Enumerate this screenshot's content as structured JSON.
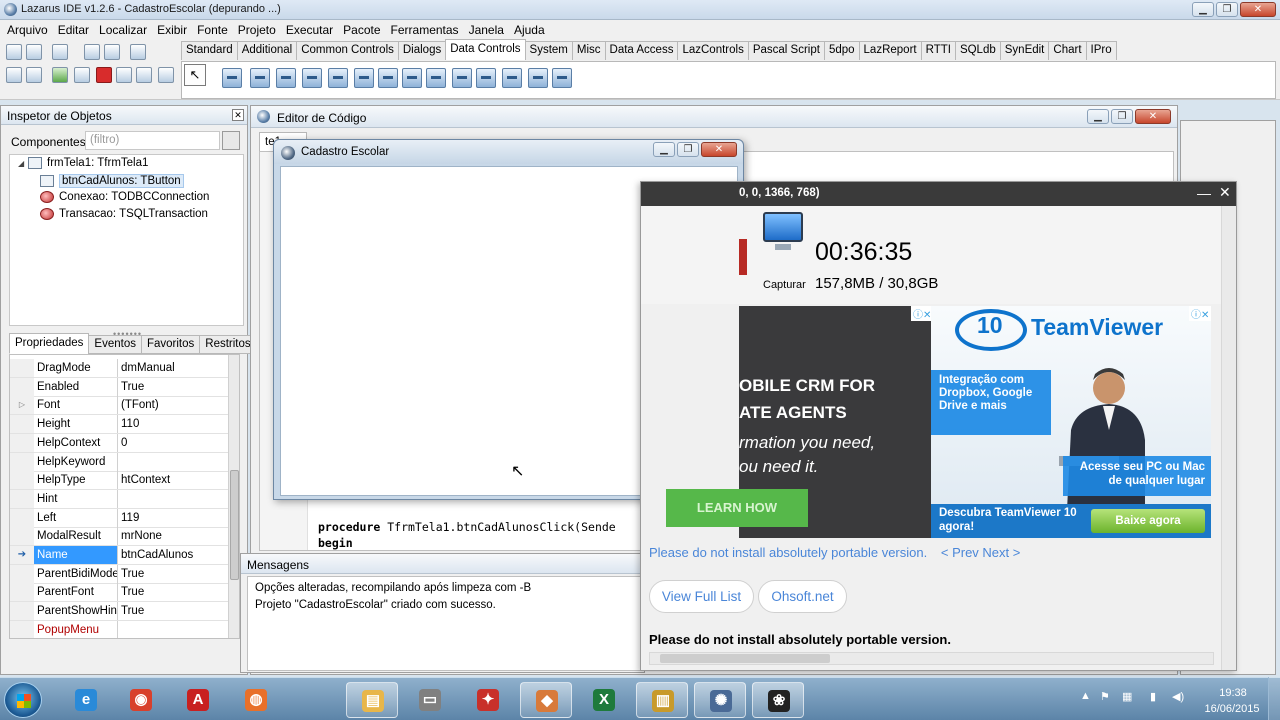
{
  "ide": {
    "title": "Lazarus IDE v1.2.6 - CadastroEscolar (depurando ...)",
    "menu": [
      "Arquivo",
      "Editar",
      "Localizar",
      "Exibir",
      "Fonte",
      "Projeto",
      "Executar",
      "Pacote",
      "Ferramentas",
      "Janela",
      "Ajuda"
    ],
    "palette_tabs": [
      "Standard",
      "Additional",
      "Common Controls",
      "Dialogs",
      "Data Controls",
      "System",
      "Misc",
      "Data Access",
      "LazControls",
      "Pascal Script",
      "5dpo",
      "LazReport",
      "RTTI",
      "SQLdb",
      "SynEdit",
      "Chart",
      "IPro"
    ],
    "active_palette_tab": "Data Controls"
  },
  "inspector": {
    "title": "Inspetor de Objetos",
    "components_label": "Componentes",
    "filter_placeholder": "(filtro)",
    "tree": [
      {
        "label": "frmTela1: TfrmTela1",
        "icon": "form-icon"
      },
      {
        "label": "btnCadAlunos: TButton",
        "icon": "button-icon",
        "selected": true
      },
      {
        "label": "Conexao: TODBCConnection",
        "icon": "database-icon"
      },
      {
        "label": "Transacao: TSQLTransaction",
        "icon": "database-icon"
      }
    ],
    "tabs": [
      "Propriedades",
      "Eventos",
      "Favoritos",
      "Restritos"
    ],
    "active_tab": "Propriedades",
    "properties": [
      {
        "name": "DragMode",
        "value": "dmManual"
      },
      {
        "name": "Enabled",
        "value": "True"
      },
      {
        "name": "Font",
        "value": "(TFont)",
        "expandable": true
      },
      {
        "name": "Height",
        "value": "110"
      },
      {
        "name": "HelpContext",
        "value": "0"
      },
      {
        "name": "HelpKeyword",
        "value": ""
      },
      {
        "name": "HelpType",
        "value": "htContext"
      },
      {
        "name": "Hint",
        "value": ""
      },
      {
        "name": "Left",
        "value": "119"
      },
      {
        "name": "ModalResult",
        "value": "mrNone"
      },
      {
        "name": "Name",
        "value": "btnCadAlunos",
        "selected": true
      },
      {
        "name": "ParentBidiMode",
        "value": "True"
      },
      {
        "name": "ParentFont",
        "value": "True"
      },
      {
        "name": "ParentShowHint",
        "value": "True"
      },
      {
        "name": "PopupMenu",
        "value": "",
        "red": true
      }
    ]
  },
  "editor": {
    "title": "Editor de Código",
    "tab": "te1",
    "code_lines": [
      {
        "kw": "procedure",
        "rest": " TfrmTela1.btnCadAlunosClick(Sende"
      },
      {
        "kw": "begin",
        "rest": ""
      }
    ]
  },
  "messages": {
    "title": "Mensagens",
    "lines": [
      "Opções alteradas, recompilando após limpeza com -B",
      "Projeto \"CadastroEscolar\" criado com sucesso."
    ]
  },
  "form": {
    "title": "Cadastro Escolar"
  },
  "recorder": {
    "title": "0, 0, 1366, 768)",
    "capture_label": "Capturar",
    "time": "00:36:35",
    "size": "157,8MB / 30,8GB",
    "ad_left": {
      "line1": "OBILE CRM FOR",
      "line2": "ATE AGENTS",
      "line3": "rmation you need,",
      "line4": "ou need it.",
      "button": "LEARN HOW"
    },
    "ad_right": {
      "logo_10": "10",
      "brand": "TeamViewer",
      "box1": "Integração com Dropbox, Google Drive e mais",
      "box2": "Acesse seu PC ou Mac de qualquer lugar",
      "box3": "Descubra TeamViewer 10 agora!",
      "button": "Baixe agora"
    },
    "warning": "Please do not install absolutely portable version.",
    "prev": "< Prev",
    "next": "Next >",
    "pill_full": "View Full List",
    "pill_ohsoft": "Ohsoft.net",
    "note": "Please do not install absolutely portable version."
  },
  "taskbar": {
    "time": "19:38",
    "date": "16/06/2015",
    "apps": [
      {
        "name": "internet-explorer",
        "glyph": "e",
        "color": "#2a8ad8",
        "open": false
      },
      {
        "name": "chrome",
        "glyph": "◉",
        "color": "#d8402c",
        "open": false
      },
      {
        "name": "acrobat",
        "glyph": "A",
        "color": "#c82020",
        "open": false
      },
      {
        "name": "firefox",
        "glyph": "◍",
        "color": "#e8702a",
        "open": false
      },
      {
        "name": "file-explorer",
        "glyph": "▤",
        "color": "#e8b64a",
        "open": true
      },
      {
        "name": "usb-drive",
        "glyph": "▭",
        "color": "#808080",
        "open": false
      },
      {
        "name": "lazarus-red",
        "glyph": "✦",
        "color": "#c8302a",
        "open": false
      },
      {
        "name": "paint",
        "glyph": "◆",
        "color": "#d87a3a",
        "open": true
      },
      {
        "name": "excel",
        "glyph": "X",
        "color": "#1e7a3c",
        "open": false
      },
      {
        "name": "database",
        "glyph": "▥",
        "color": "#c89a2a",
        "open": true
      },
      {
        "name": "lazarus",
        "glyph": "✺",
        "color": "#4a6a96",
        "open": true
      },
      {
        "name": "paw",
        "glyph": "❀",
        "color": "#222222",
        "open": true
      }
    ]
  }
}
